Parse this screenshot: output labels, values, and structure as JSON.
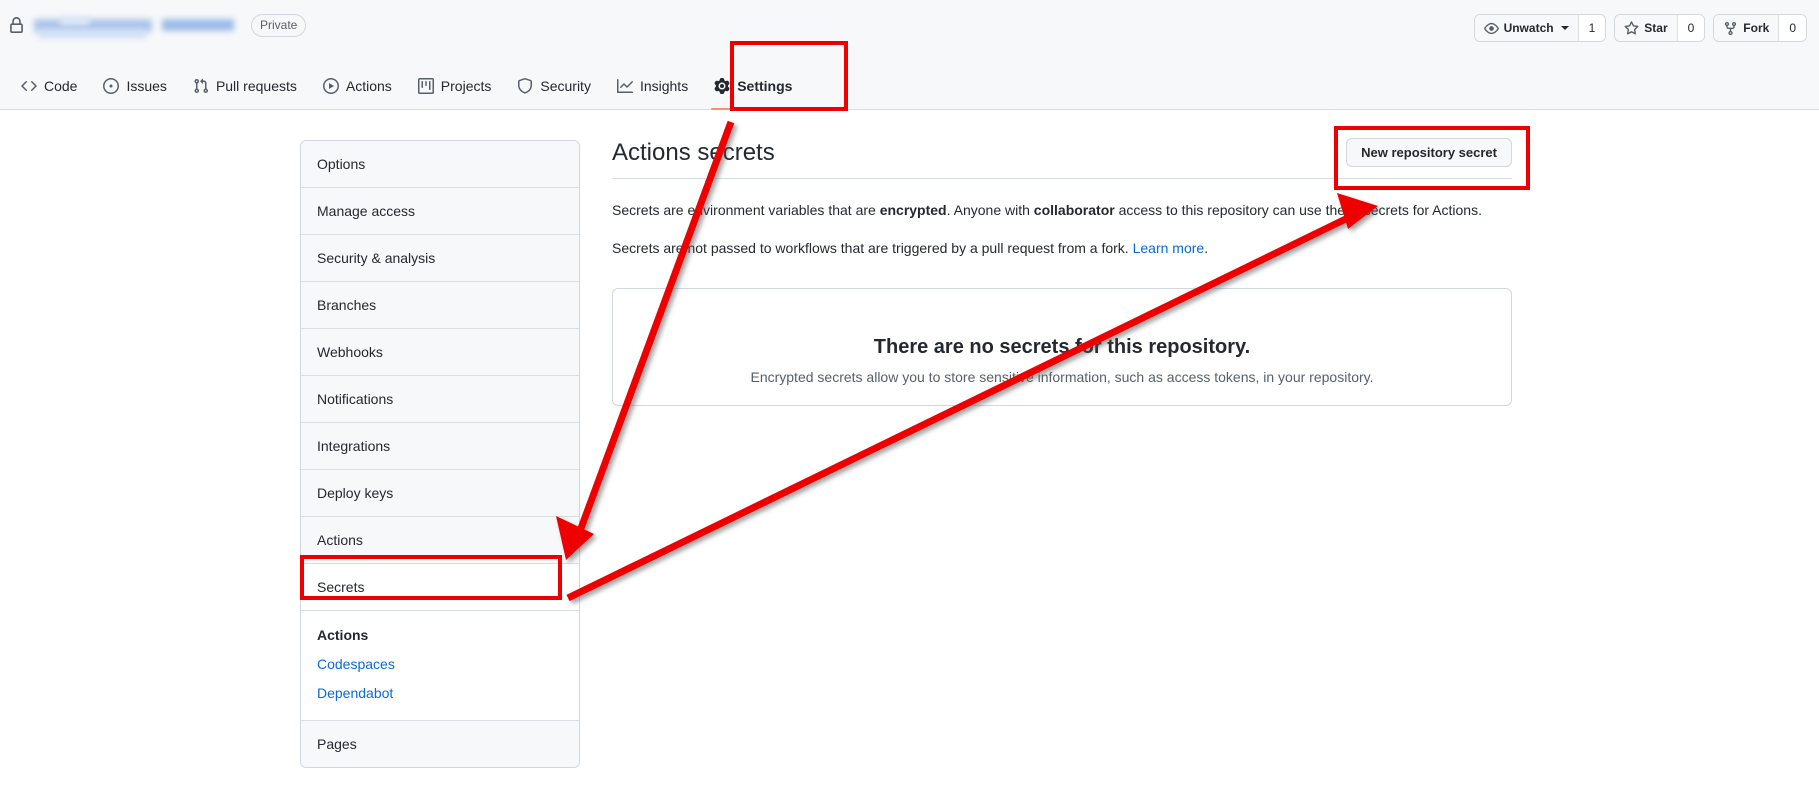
{
  "header": {
    "lock_icon": "lock-icon",
    "repo_name_redacted": "",
    "visibility": "Private",
    "actions": [
      {
        "icon": "eye-icon",
        "label": "Unwatch",
        "count": "1",
        "has_caret": true
      },
      {
        "icon": "star-icon",
        "label": "Star",
        "count": "0",
        "has_caret": false
      },
      {
        "icon": "fork-icon",
        "label": "Fork",
        "count": "0",
        "has_caret": false
      }
    ]
  },
  "nav": {
    "tabs": [
      {
        "label": "Code",
        "icon": "code-icon",
        "selected": false
      },
      {
        "label": "Issues",
        "icon": "issue-opened-icon",
        "selected": false
      },
      {
        "label": "Pull requests",
        "icon": "git-pull-request-icon",
        "selected": false
      },
      {
        "label": "Actions",
        "icon": "play-icon",
        "selected": false
      },
      {
        "label": "Projects",
        "icon": "project-icon",
        "selected": false
      },
      {
        "label": "Security",
        "icon": "shield-icon",
        "selected": false
      },
      {
        "label": "Insights",
        "icon": "graph-icon",
        "selected": false
      },
      {
        "label": "Settings",
        "icon": "gear-icon",
        "selected": true
      }
    ]
  },
  "sidebar": {
    "items": [
      {
        "label": "Options"
      },
      {
        "label": "Manage access"
      },
      {
        "label": "Security & analysis"
      },
      {
        "label": "Branches"
      },
      {
        "label": "Webhooks"
      },
      {
        "label": "Notifications"
      },
      {
        "label": "Integrations"
      },
      {
        "label": "Deploy keys"
      },
      {
        "label": "Actions"
      },
      {
        "label": "Secrets"
      }
    ],
    "subgroup": {
      "title": "Actions",
      "links": [
        {
          "label": "Codespaces"
        },
        {
          "label": "Dependabot"
        }
      ]
    },
    "last_item": {
      "label": "Pages"
    }
  },
  "main": {
    "title": "Actions secrets",
    "new_secret_button": "New repository secret",
    "desc1": {
      "part1": "Secrets are environment variables that are ",
      "bold1": "encrypted",
      "part2": ". Anyone with ",
      "bold2": "collaborator",
      "part3": " access to this repository can use these secrets for Actions."
    },
    "desc2": {
      "part1": "Secrets are not passed to workflows that are triggered by a pull request from a fork. ",
      "link": "Learn more",
      "part2": "."
    },
    "empty_state": {
      "title": "There are no secrets for this repository.",
      "subtitle": "Encrypted secrets allow you to store sensitive information, such as access tokens, in your repository."
    }
  },
  "annotations": {
    "color": "#ee0000",
    "boxes": [
      {
        "name": "settings-tab-highlight"
      },
      {
        "name": "secrets-sidebar-highlight"
      },
      {
        "name": "new-repository-secret-highlight"
      }
    ],
    "arrows": [
      {
        "name": "arrow-settings-to-secrets"
      },
      {
        "name": "arrow-secrets-to-new-secret"
      }
    ]
  },
  "theme": {
    "accent": "#0969da",
    "active_tab_underline": "#fd8c73",
    "annotation_red": "#ee0000",
    "border": "#d0d7de",
    "header_bg": "#f6f8fa"
  }
}
